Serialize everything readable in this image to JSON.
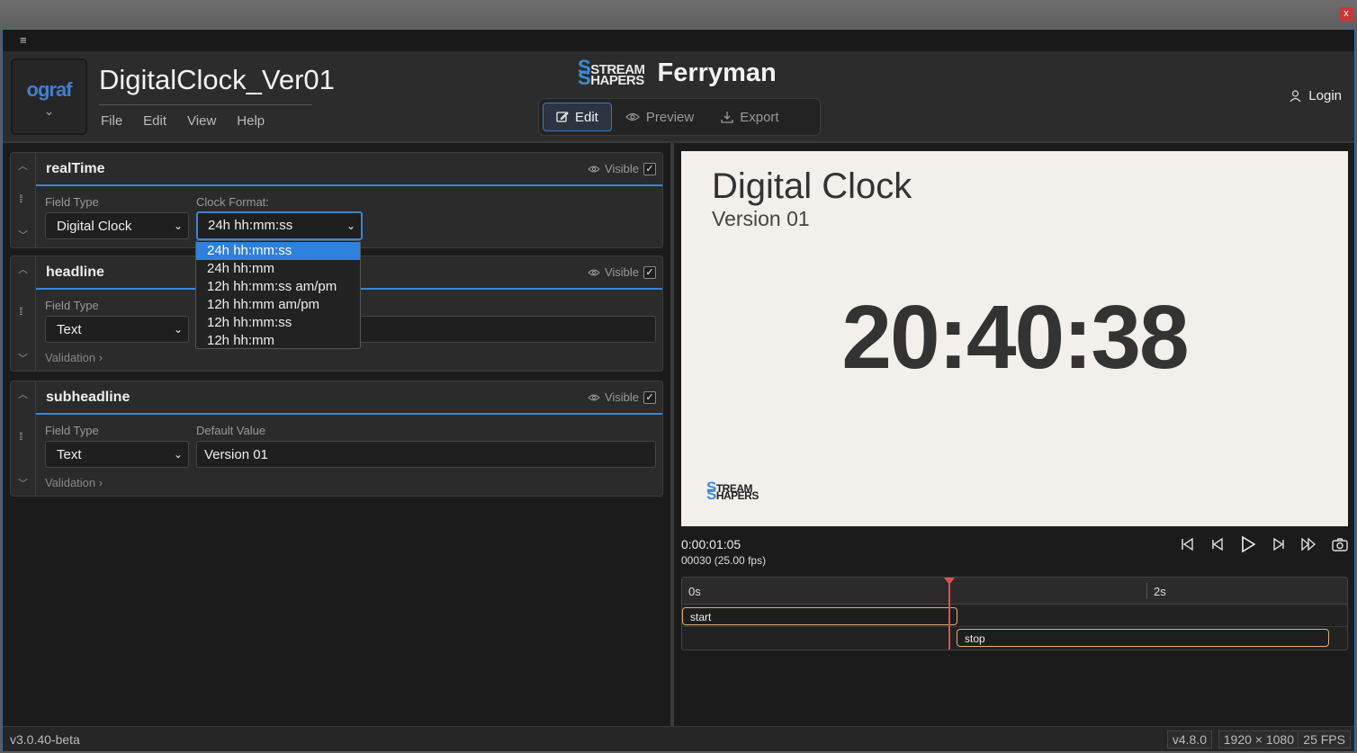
{
  "window": {
    "close_label": "x"
  },
  "menubar": {
    "hamburger": "≡"
  },
  "header": {
    "logo_text": "ograf",
    "doc_title": "DigitalClock_Ver01",
    "menu": [
      "File",
      "Edit",
      "View",
      "Help"
    ],
    "brand_logo_line1": "STREAM",
    "brand_logo_line2": "HAPERS",
    "brand_logo_initial1": "S",
    "brand_logo_initial2": "S",
    "brand_name": "Ferryman",
    "modes": [
      {
        "label": "Edit",
        "icon": "pencil-icon",
        "active": true
      },
      {
        "label": "Preview",
        "icon": "eye-icon",
        "active": false
      },
      {
        "label": "Export",
        "icon": "download-icon",
        "active": false
      }
    ],
    "login_label": "Login"
  },
  "fields": [
    {
      "name": "realTime",
      "visible_label": "Visible",
      "field_type_label": "Field Type",
      "field_type_value": "Digital Clock",
      "second_label": "Clock Format:",
      "second_value": "24h hh:mm:ss"
    },
    {
      "name": "headline",
      "visible_label": "Visible",
      "field_type_label": "Field Type",
      "field_type_value": "Text",
      "second_value": "",
      "validation_label": "Validation"
    },
    {
      "name": "subheadline",
      "visible_label": "Visible",
      "field_type_label": "Field Type",
      "field_type_value": "Text",
      "second_label": "Default Value",
      "second_value": "Version 01",
      "validation_label": "Validation"
    }
  ],
  "clock_format_options": [
    "24h hh:mm:ss",
    "24h hh:mm",
    "12h hh:mm:ss am/pm",
    "12h hh:mm am/pm",
    "12h hh:mm:ss",
    "12h hh:mm"
  ],
  "clock_format_selected": "24h hh:mm:ss",
  "preview": {
    "title": "Digital Clock",
    "subtitle": "Version 01",
    "clock": "20:40:38",
    "logo_line1": "TREAM",
    "logo_line2": "HAPERS",
    "logo_initial1": "S",
    "logo_initial2": "S"
  },
  "playback": {
    "timecode": "0:00:01:05",
    "frame_info": "00030 (25.00 fps)",
    "controls": [
      "skip-to-start-icon",
      "step-back-icon",
      "play-icon",
      "step-forward-icon",
      "skip-to-end-icon",
      "camera-icon"
    ]
  },
  "timeline": {
    "ticks": [
      "0s",
      "2s"
    ],
    "clips": [
      "start",
      "stop"
    ],
    "playhead_time_s": 1.2
  },
  "status": {
    "version": "v3.0.40-beta",
    "badges": [
      "v4.8.0",
      "1920 × 1080",
      "25 FPS"
    ]
  },
  "colors": {
    "accent": "#2f7fdc",
    "playhead": "#d9534f",
    "clip_border": "#e0b070"
  }
}
